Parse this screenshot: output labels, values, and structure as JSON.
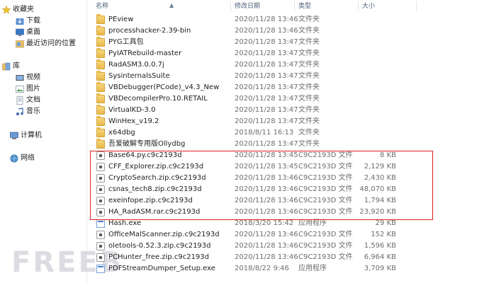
{
  "nav": {
    "favorites": "收藏夹",
    "downloads": "下载",
    "desktop": "桌面",
    "recent": "最近访问的位置",
    "libraries": "库",
    "videos": "视频",
    "pictures": "图片",
    "documents": "文档",
    "music": "音乐",
    "computer": "计算机",
    "network": "网络"
  },
  "columns": {
    "name": "名称",
    "date": "修改日期",
    "type": "类型",
    "size": "大小"
  },
  "files": [
    {
      "name": "PEview",
      "date": "2020/11/28 13:46",
      "type": "文件夹",
      "size": "",
      "icon": "folder"
    },
    {
      "name": "processhacker-2.39-bin",
      "date": "2020/11/28 13:46",
      "type": "文件夹",
      "size": "",
      "icon": "folder"
    },
    {
      "name": "PYG工具包",
      "date": "2020/11/28 13:47",
      "type": "文件夹",
      "size": "",
      "icon": "folder"
    },
    {
      "name": "PyIATRebuild-master",
      "date": "2020/11/28 13:47",
      "type": "文件夹",
      "size": "",
      "icon": "folder"
    },
    {
      "name": "RadASM3.0.0.7j",
      "date": "2020/11/28 13:47",
      "type": "文件夹",
      "size": "",
      "icon": "folder"
    },
    {
      "name": "SysinternalsSuite",
      "date": "2020/11/28 13:47",
      "type": "文件夹",
      "size": "",
      "icon": "folder"
    },
    {
      "name": "VBDebugger(PCode)_v4.3_New",
      "date": "2020/11/28 13:47",
      "type": "文件夹",
      "size": "",
      "icon": "folder"
    },
    {
      "name": "VBDecompilerPro.10.RETAIL",
      "date": "2020/11/28 13:47",
      "type": "文件夹",
      "size": "",
      "icon": "folder"
    },
    {
      "name": "VirtualKD-3.0",
      "date": "2020/11/28 13:47",
      "type": "文件夹",
      "size": "",
      "icon": "folder"
    },
    {
      "name": "WinHex_v19.2",
      "date": "2020/11/28 13:47",
      "type": "文件夹",
      "size": "",
      "icon": "folder"
    },
    {
      "name": "x64dbg",
      "date": "2018/8/11 16:13",
      "type": "文件夹",
      "size": "",
      "icon": "folder"
    },
    {
      "name": "吾爱破解专用版Ollydbg",
      "date": "2020/11/28 13:47",
      "type": "文件夹",
      "size": "",
      "icon": "folder"
    },
    {
      "name": "Base64.py.c9c2193d",
      "date": "2020/11/28 13:45",
      "type": "C9C2193D 文件",
      "size": "8 KB",
      "icon": "lock"
    },
    {
      "name": "CFF_Explorer.zip.c9c2193d",
      "date": "2020/11/28 13:45",
      "type": "C9C2193D 文件",
      "size": "2,129 KB",
      "icon": "lock"
    },
    {
      "name": "CryptoSearch.zip.c9c2193d",
      "date": "2020/11/28 13:46",
      "type": "C9C2193D 文件",
      "size": "2,430 KB",
      "icon": "lock"
    },
    {
      "name": "csnas_tech8.zip.c9c2193d",
      "date": "2020/11/28 13:46",
      "type": "C9C2193D 文件",
      "size": "48,070 KB",
      "icon": "lock"
    },
    {
      "name": "exeinfope.zip.c9c2193d",
      "date": "2020/11/28 13:46",
      "type": "C9C2193D 文件",
      "size": "1,794 KB",
      "icon": "lock"
    },
    {
      "name": "HA_RadASM.rar.c9c2193d",
      "date": "2020/11/28 13:46",
      "type": "C9C2193D 文件",
      "size": "23,920 KB",
      "icon": "lock"
    },
    {
      "name": "Hash.exe",
      "date": "2018/3/20 15:42",
      "type": "应用程序",
      "size": "29 KB",
      "icon": "exe"
    },
    {
      "name": "OfficeMalScanner.zip.c9c2193d",
      "date": "2020/11/28 13:46",
      "type": "C9C2193D 文件",
      "size": "152 KB",
      "icon": "lock"
    },
    {
      "name": "oletools-0.52.3.zip.c9c2193d",
      "date": "2020/11/28 13:46",
      "type": "C9C2193D 文件",
      "size": "1,596 KB",
      "icon": "lock"
    },
    {
      "name": "PCHunter_free.zip.c9c2193d",
      "date": "2020/11/28 13:46",
      "type": "C9C2193D 文件",
      "size": "6,964 KB",
      "icon": "lock"
    },
    {
      "name": "PDFStreamDumper_Setup.exe",
      "date": "2018/8/22 9:46",
      "type": "应用程序",
      "size": "3,709 KB",
      "icon": "exe"
    }
  ],
  "watermark": "FREEB",
  "colors": {
    "highlight": "#e02020",
    "folder": "#e8b84a",
    "header_text": "#4c607a"
  }
}
